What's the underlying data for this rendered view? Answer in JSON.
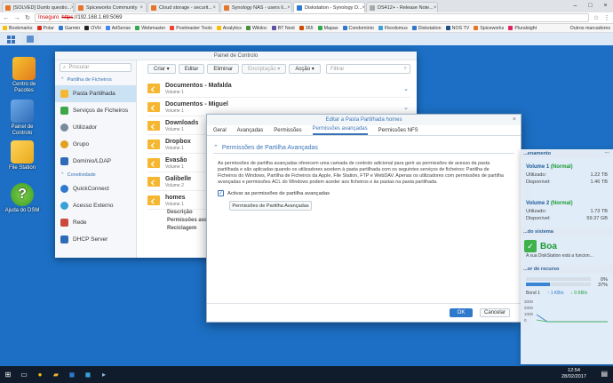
{
  "browser": {
    "tabs": [
      {
        "label": "[SOLVED] Dumb questio...",
        "color": "#e8742a"
      },
      {
        "label": "Spiceworks Community",
        "color": "#e8742a"
      },
      {
        "label": "Cloud storage - securit...",
        "color": "#e8742a"
      },
      {
        "label": "Synology NAS - users li...",
        "color": "#e8742a"
      },
      {
        "label": "Diskstation - Synology D...",
        "color": "#2f79cc"
      },
      {
        "label": "DS412+ - Release Note...",
        "color": "#aaaaaa"
      }
    ],
    "active_tab": 4,
    "url_warning": "Inseguro",
    "url_scheme": "https",
    "url_rest": "://192.168.1.69:5069",
    "bookmarks": [
      "Bookmarks",
      "Polar",
      "Garmin",
      "OVH",
      "AdSense",
      "Webmaster",
      "Postmaster Tools",
      "Analytics",
      "Wikiloc",
      "BT Next",
      "365",
      "Mapas",
      "Condominio",
      "Flexdomus",
      "Diskstation",
      "NOS TV",
      "Spiceworks",
      "Pluralsight"
    ],
    "other_bookmarks": "Outros marcadores"
  },
  "desktop": {
    "icons": [
      "Centro de Pacotes",
      "Painel de Controlo",
      "File Station",
      "Ajuda do DSM"
    ]
  },
  "control_panel": {
    "title": "Painel de Controlo",
    "search_placeholder": "Procurar",
    "sections": {
      "file_sharing": "Partilha de Ficheiros",
      "connectivity": "Conetividade"
    },
    "sidebar": [
      "Pasta Partilhada",
      "Serviços de Ficheiros",
      "Utilizador",
      "Grupo",
      "Domínio/LDAP",
      "QuickConnect",
      "Acesso Externo",
      "Rede",
      "DHCP Server"
    ],
    "toolbar": {
      "create": "Criar",
      "edit": "Editar",
      "delete": "Eliminar",
      "encrypt": "Encriptação",
      "action": "Acção"
    },
    "filter_placeholder": "Filtrar",
    "shares": [
      {
        "name": "Documentos - Mafalda",
        "volume": "Volume 1"
      },
      {
        "name": "Documentos - Miguel",
        "volume": "Volume 1"
      },
      {
        "name": "Downloads",
        "volume": "Volume 1"
      },
      {
        "name": "Dropbox",
        "volume": "Volume 1"
      },
      {
        "name": "Evasão",
        "volume": "Volume 1"
      },
      {
        "name": "Galibelle",
        "volume": "Volume 2"
      },
      {
        "name": "homes",
        "volume": "Volume 1"
      }
    ],
    "homes_menu": [
      "Descrição",
      "Permissões avançadas",
      "Reciclagem"
    ]
  },
  "dialog": {
    "title": "Editar a Pasta Partilhada homes",
    "tabs": [
      "Geral",
      "Avançadas",
      "Permissões",
      "Permissões avançadas",
      "Permissões NFS"
    ],
    "active_tab": 3,
    "section_title": "Permissões de Partilha Avançadas",
    "body": "As permissões de partilha avançadas oferecem uma camada de controlo adicional para gerir as permissões de acesso da pasta partilhada e são aplicadas quando os utilizadores acedem à pasta partilhada com os seguintes serviços de ficheiros: Partilha de Ficheiros do Windows, Partilha de Ficheiros da Apple, File Station, FTP e WebDAV. Apenas os utilizadores com permissões de partilha avançadas e permissões ACL do Windows podem aceder aos ficheiros e às pastas na pasta partilhada.",
    "checkbox_label": "Activar as permissões de partilha avançadas",
    "checkbox_checked": true,
    "adv_button": "Permissões de Partilha Avançadas",
    "ok": "OK",
    "cancel": "Cancelar"
  },
  "widgets": {
    "storage_header": "...enamento",
    "vol1_title": "Volume 1",
    "vol1_status": "(Normal)",
    "vol1_used_label": "Utilizado:",
    "vol1_used": "1.22 TB",
    "vol1_free_label": "Disponível:",
    "vol1_free": "1.46 TB",
    "vol2_title": "Volume 2",
    "vol2_status": "(Normal)",
    "vol2_used_label": "Utilizado:",
    "vol2_used": "1.73 TB",
    "vol2_free_label": "Disponível:",
    "vol2_free": "59.37 GB",
    "system_header": "...do sistema",
    "health": "Boa",
    "health_desc": "A sua DiskStation está a funcion...",
    "resource_header": "...or de recurso",
    "cpu_pct": "0%",
    "cpu_value": 0,
    "ram_pct": "37%",
    "ram_value": 37,
    "net_label": "Bond 1",
    "up": "1 KB/s",
    "down": "0 KB/s",
    "chart_ticks": [
      "3000",
      "2000",
      "1000",
      "0"
    ]
  },
  "taskbar": {
    "time": "12:54",
    "date": "28/02/2017"
  }
}
